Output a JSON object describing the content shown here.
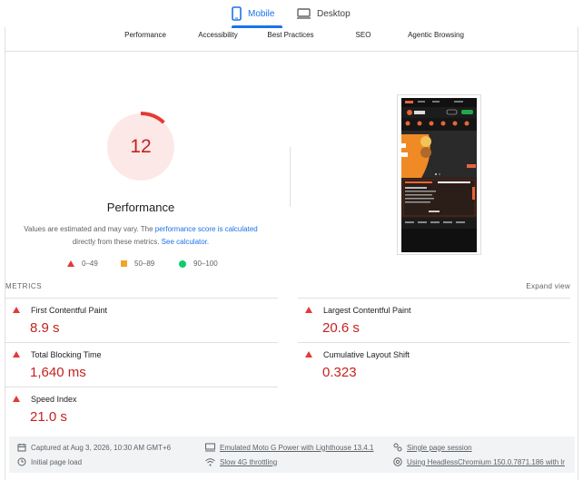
{
  "device_tabs": [
    {
      "label": "Mobile",
      "active": true
    },
    {
      "label": "Desktop",
      "active": false
    }
  ],
  "category_tabs": [
    "Performance",
    "Accessibility",
    "Best Practices",
    "SEO",
    "Agentic Browsing"
  ],
  "performance": {
    "score": "12",
    "score_fraction": 0.12,
    "title": "Performance",
    "note_prefix": "Values are estimated and may vary. The ",
    "note_link1": "performance score is calculated",
    "note_middle": " directly from these metrics. ",
    "note_link2": "See calculator.",
    "legend": [
      {
        "range": "0–49",
        "shape": "triangle",
        "color": "#e53935"
      },
      {
        "range": "50–89",
        "shape": "square",
        "color": "#f4a42c"
      },
      {
        "range": "90–100",
        "shape": "circle",
        "color": "#0cce6b"
      }
    ]
  },
  "metrics": {
    "heading": "METRICS",
    "expand_label": "Expand view",
    "items": [
      {
        "name": "First Contentful Paint",
        "value": "8.9 s"
      },
      {
        "name": "Largest Contentful Paint",
        "value": "20.6 s"
      },
      {
        "name": "Total Blocking Time",
        "value": "1,640 ms"
      },
      {
        "name": "Cumulative Layout Shift",
        "value": "0.323"
      },
      {
        "name": "Speed Index",
        "value": "21.0 s"
      }
    ]
  },
  "footer": {
    "captured": "Captured at Aug 3, 2026, 10:30 AM GMT+6",
    "initial_load": "Initial page load",
    "emulated": "Emulated Moto G Power with Lighthouse 13.4.1",
    "throttling": "Slow 4G throttling",
    "session": "Single page session",
    "browser": "Using HeadlessChromium 150.0.7871.186 with lr"
  },
  "colors": {
    "accent": "#1a73e8",
    "fail": "#c5221f",
    "fail_icon": "#e53935",
    "gauge_bg": "#fce8e6"
  }
}
